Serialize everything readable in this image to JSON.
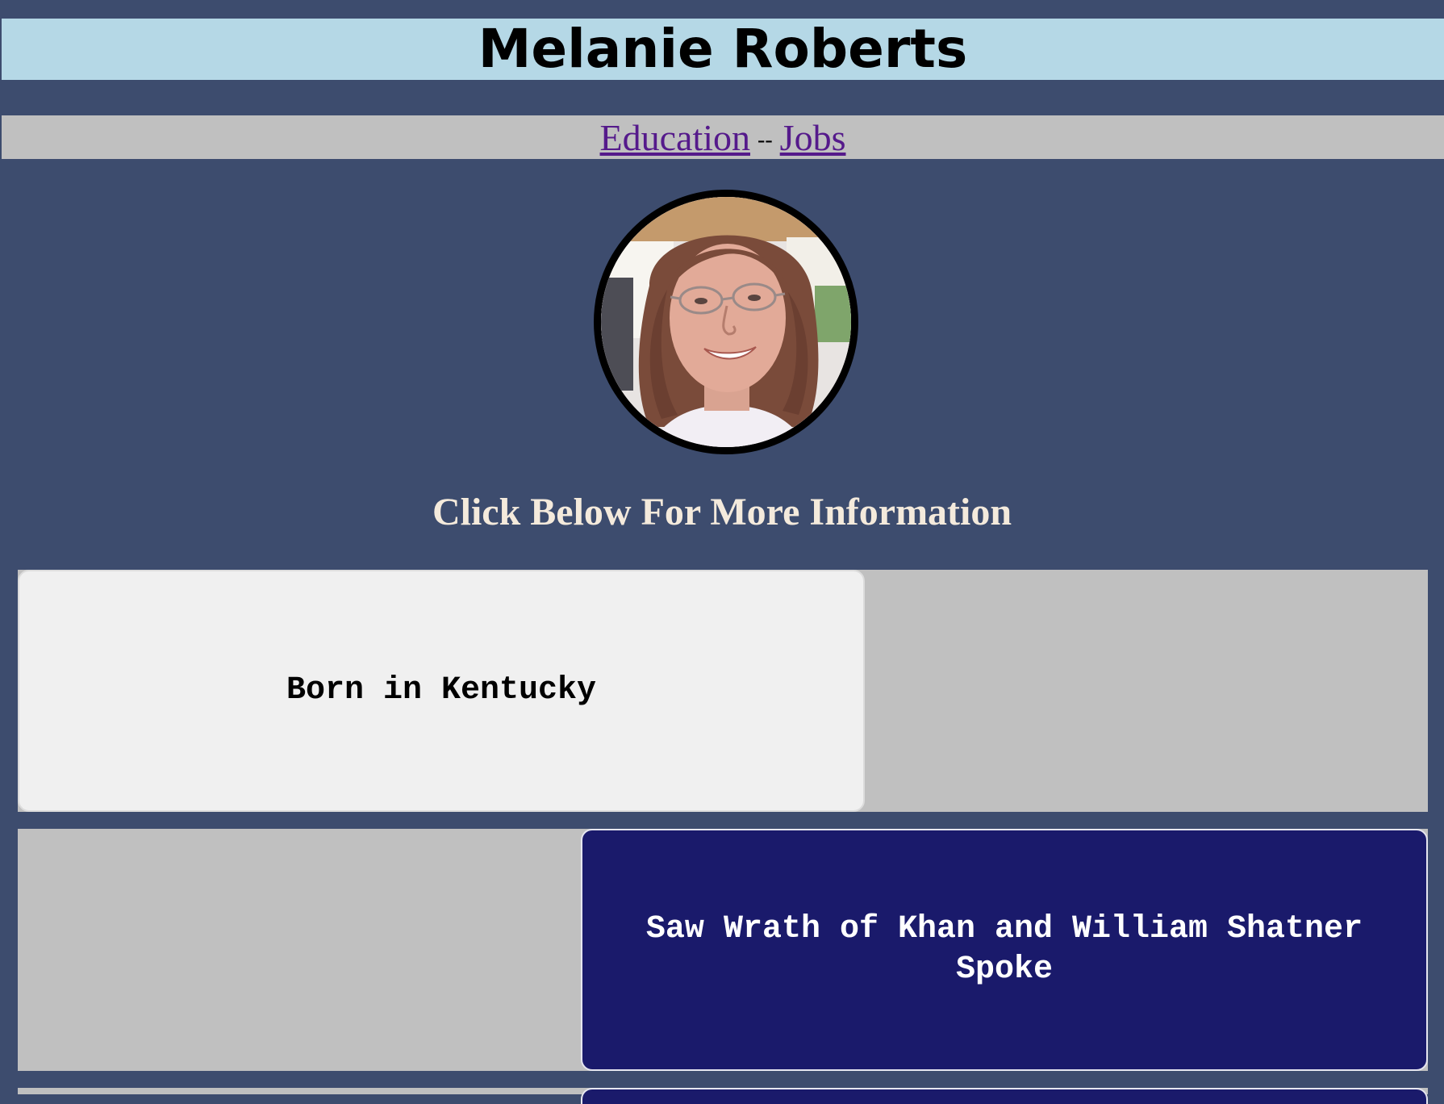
{
  "header": {
    "title": "Melanie Roberts",
    "background": "#b5d8e6"
  },
  "nav": {
    "links": [
      {
        "label": "Education"
      },
      {
        "label": "Jobs"
      }
    ],
    "separator": "--",
    "link_color": "#551a8b"
  },
  "profile": {
    "avatar_icon": "profile-photo"
  },
  "cta": {
    "text": "Click Below For More Information"
  },
  "cards": [
    {
      "text": "Born in Kentucky",
      "style": "light"
    },
    {
      "text": "Saw Wrath of Khan and William Shatner Spoke",
      "style": "dark"
    }
  ],
  "colors": {
    "page_background": "#3d4c6e",
    "row_background": "#c0c0c0",
    "card_light": "#f0f0f0",
    "card_dark": "#1a1a6b",
    "cta_text": "#f4eadc"
  }
}
